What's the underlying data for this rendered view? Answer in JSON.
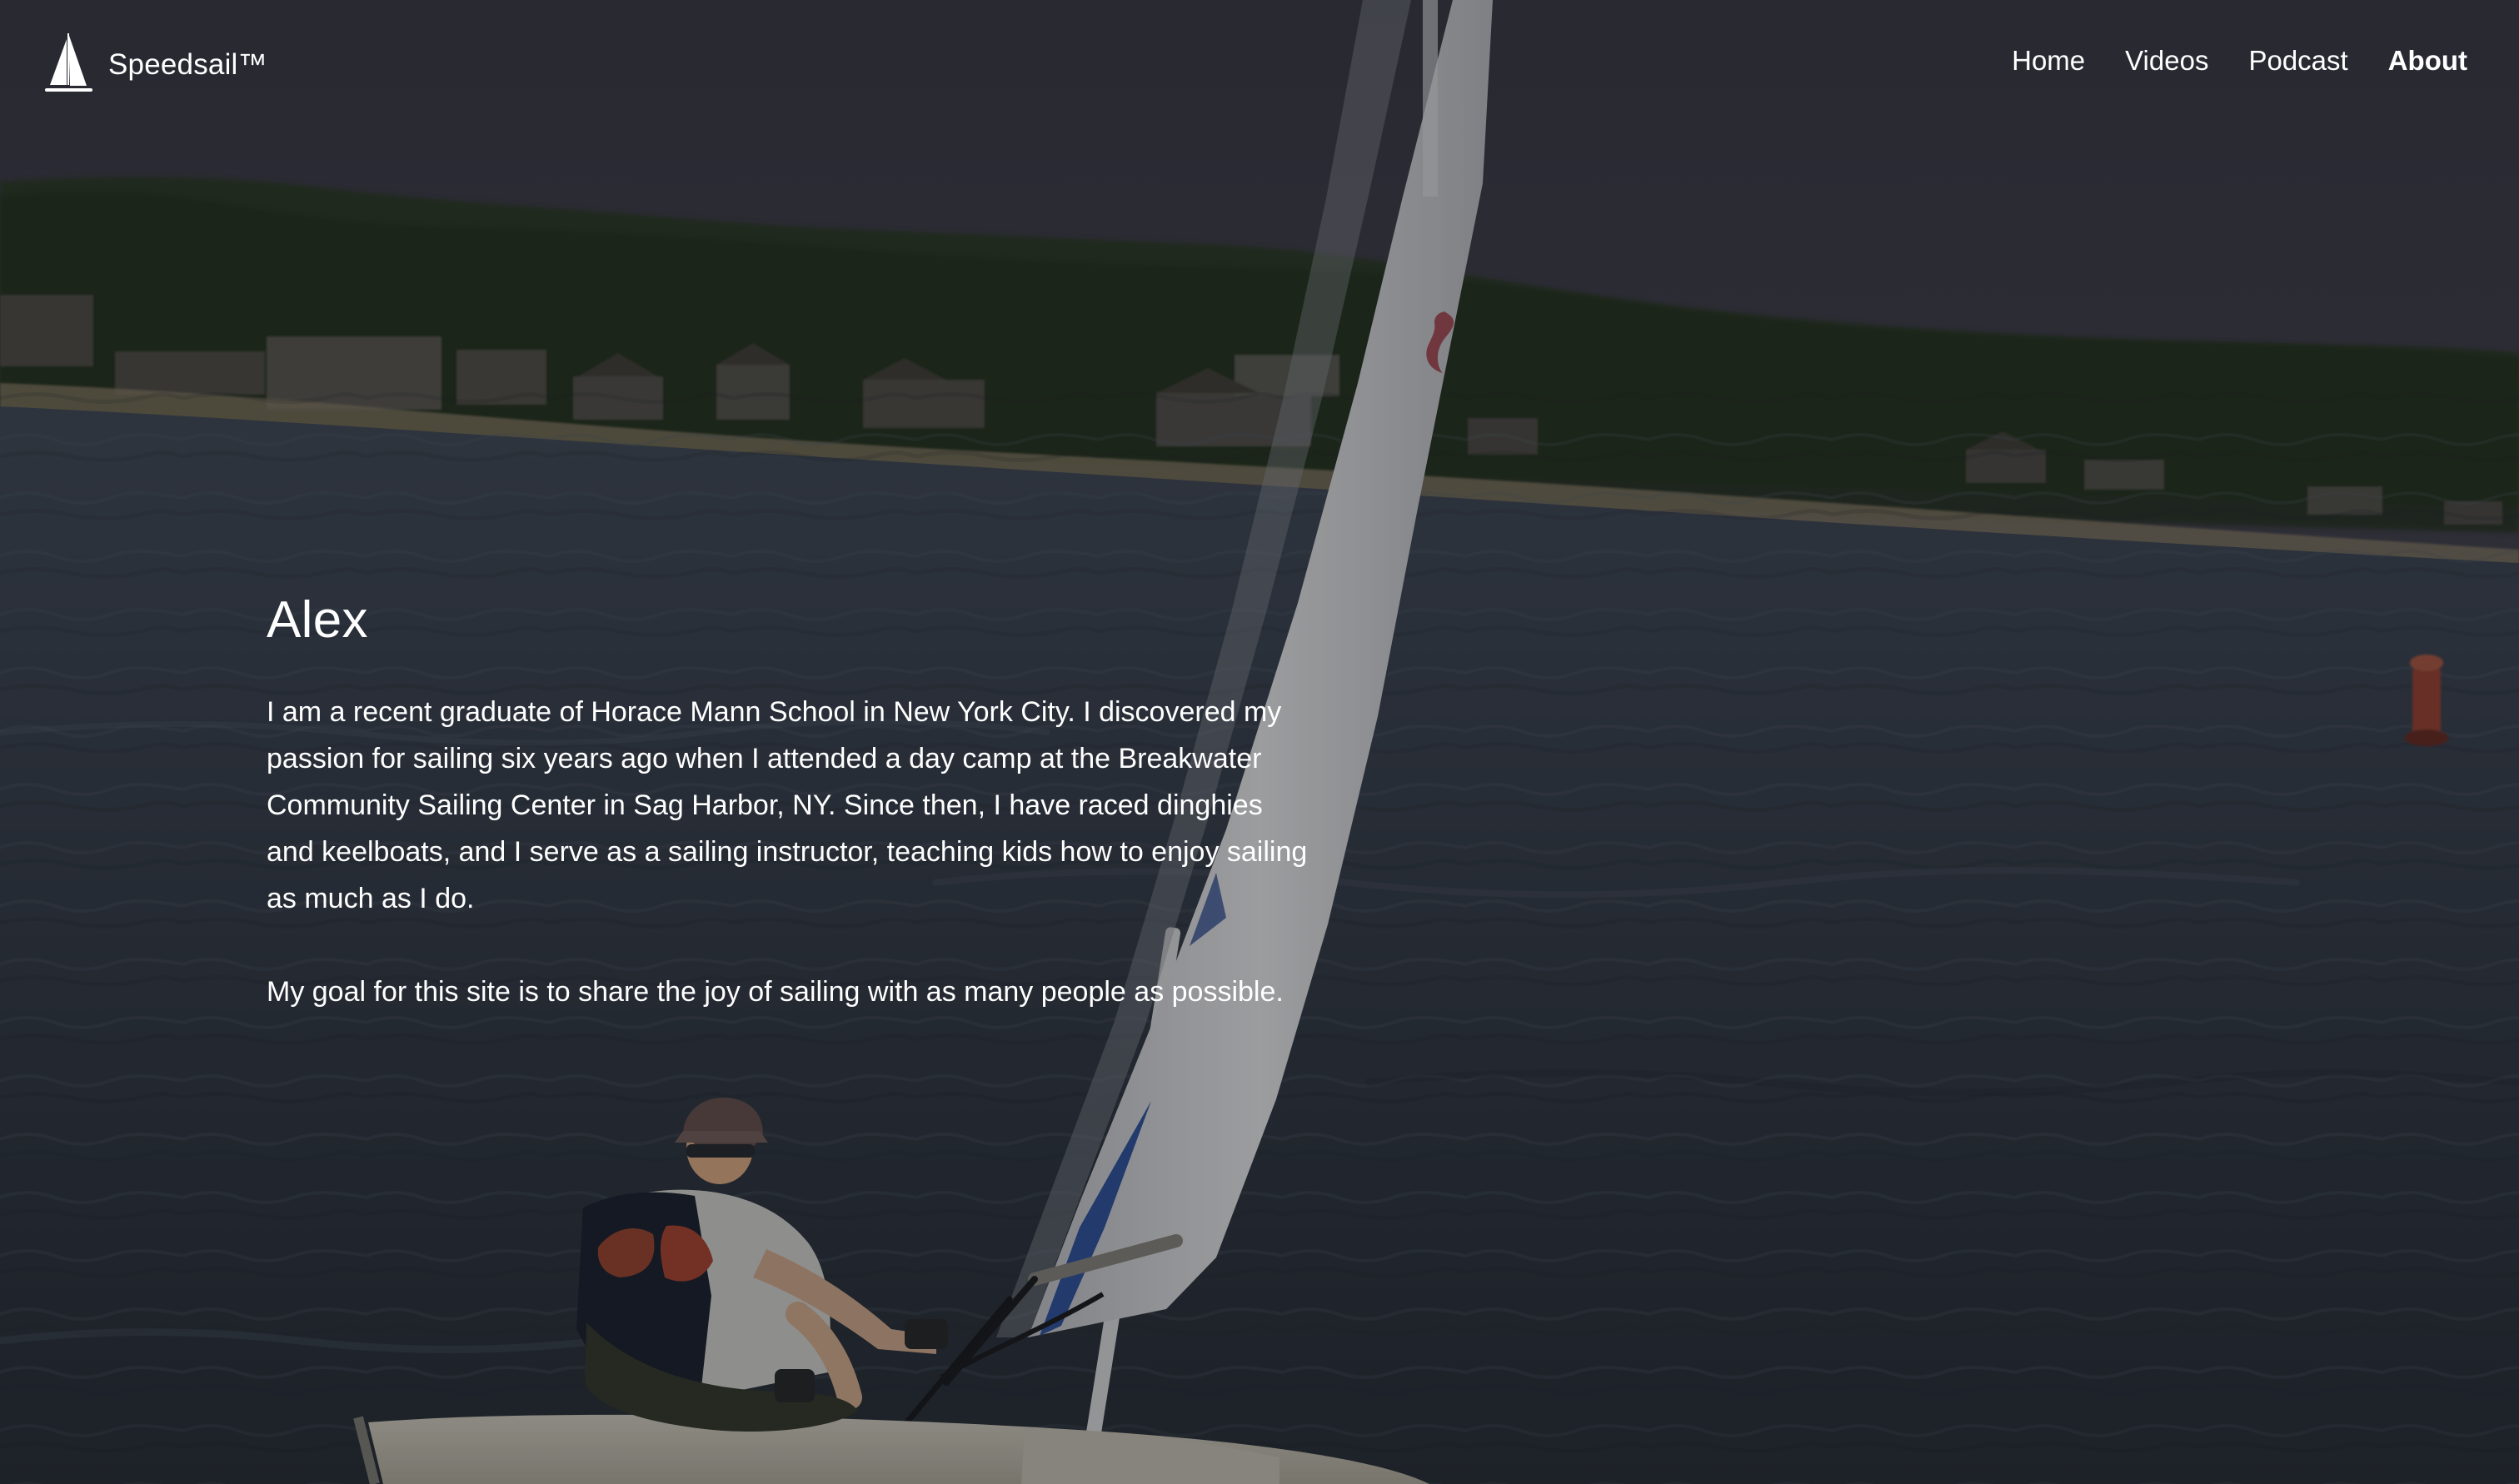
{
  "site": {
    "brand_name": "Speedsail™"
  },
  "navigation": {
    "items": [
      {
        "label": "Home",
        "active": false
      },
      {
        "label": "Videos",
        "active": false
      },
      {
        "label": "Podcast",
        "active": false
      },
      {
        "label": "About",
        "active": true
      }
    ]
  },
  "profile": {
    "title": "Alex",
    "paragraphs": [
      "I am a recent graduate of Horace Mann School in New York City. I discovered my passion for sailing six years ago when I attended a day camp at the Breakwater Community Sailing Center in Sag Harbor, NY. Since then, I have raced dinghies and keelboats, and I serve as a sailing instructor, teaching kids how to enjoy sailing as much as I do.",
      "My goal for this site is to share the joy of sailing with as many people as possible."
    ]
  },
  "icons": {
    "logo": "sailboat-icon"
  },
  "theme": {
    "text_color": "#ffffff",
    "overlay_color": "#2f3036",
    "sky_color": "#4a4a56",
    "water_color": "#3b4350",
    "trees_color": "#34402f",
    "sail_color": "#d9dce3",
    "accent_blue": "#355aa7",
    "buoy_color": "#a24b3f"
  }
}
